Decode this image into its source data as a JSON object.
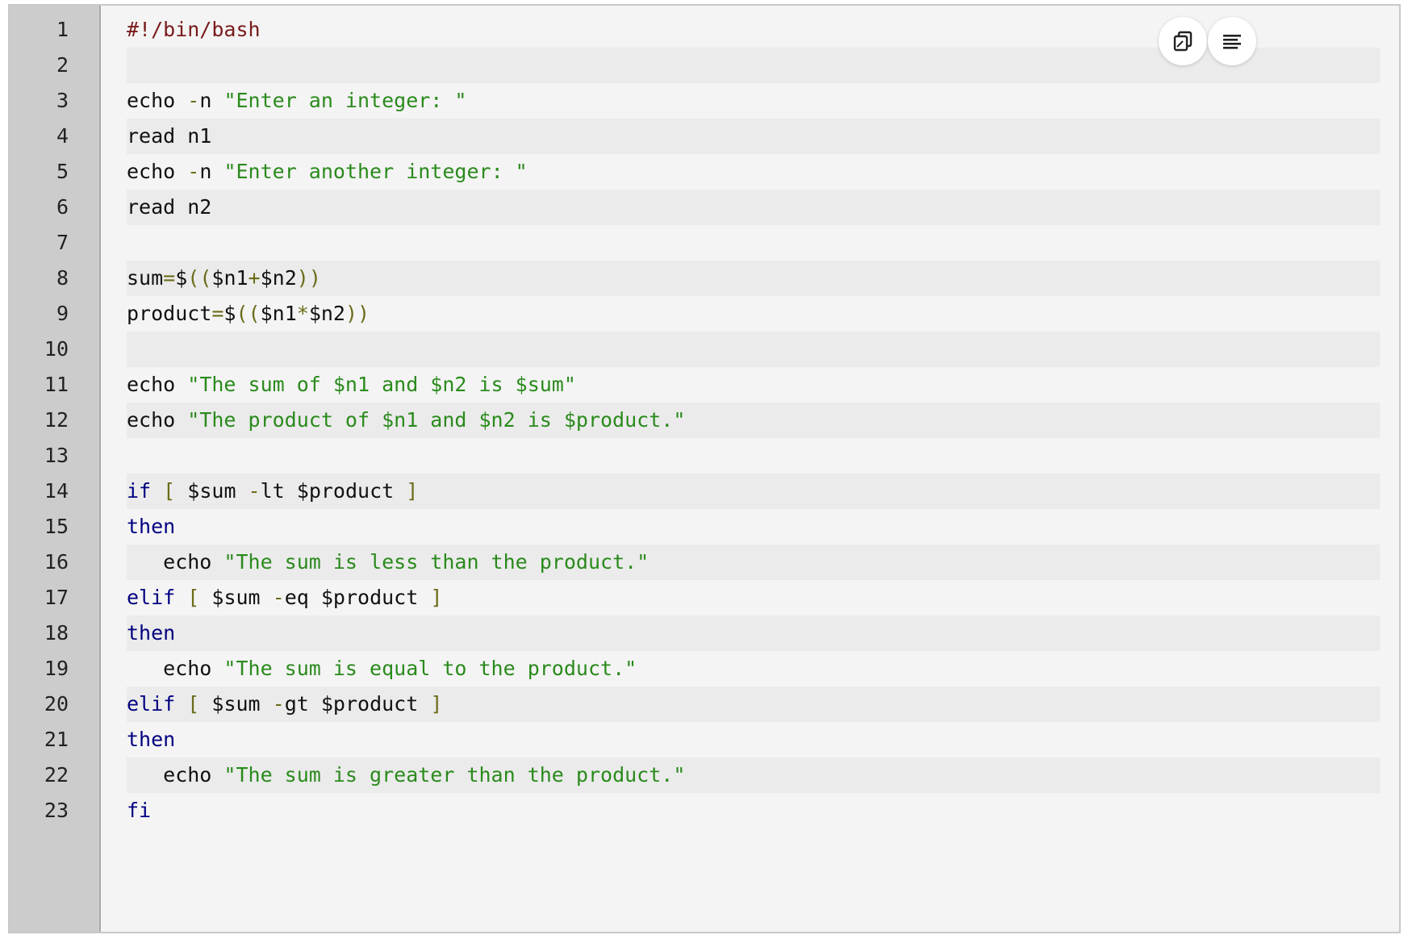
{
  "toolbar": {
    "copy_icon": "copy-icon",
    "wrap_icon": "text-lines-icon"
  },
  "lines": [
    {
      "n": "1",
      "tokens": [
        {
          "t": "shebang",
          "v": "#!/bin/bash"
        }
      ]
    },
    {
      "n": "2",
      "tokens": []
    },
    {
      "n": "3",
      "tokens": [
        {
          "t": "plain",
          "v": "echo "
        },
        {
          "t": "op",
          "v": "-"
        },
        {
          "t": "plain",
          "v": "n "
        },
        {
          "t": "str",
          "v": "\"Enter an integer: \""
        }
      ]
    },
    {
      "n": "4",
      "tokens": [
        {
          "t": "plain",
          "v": "read n1"
        }
      ]
    },
    {
      "n": "5",
      "tokens": [
        {
          "t": "plain",
          "v": "echo "
        },
        {
          "t": "op",
          "v": "-"
        },
        {
          "t": "plain",
          "v": "n "
        },
        {
          "t": "str",
          "v": "\"Enter another integer: \""
        }
      ]
    },
    {
      "n": "6",
      "tokens": [
        {
          "t": "plain",
          "v": "read n2"
        }
      ]
    },
    {
      "n": "7",
      "tokens": []
    },
    {
      "n": "8",
      "tokens": [
        {
          "t": "plain",
          "v": "sum"
        },
        {
          "t": "op",
          "v": "="
        },
        {
          "t": "plain",
          "v": "$"
        },
        {
          "t": "op",
          "v": "(("
        },
        {
          "t": "plain",
          "v": "$n1"
        },
        {
          "t": "op",
          "v": "+"
        },
        {
          "t": "plain",
          "v": "$n2"
        },
        {
          "t": "op",
          "v": "))"
        }
      ]
    },
    {
      "n": "9",
      "tokens": [
        {
          "t": "plain",
          "v": "product"
        },
        {
          "t": "op",
          "v": "="
        },
        {
          "t": "plain",
          "v": "$"
        },
        {
          "t": "op",
          "v": "(("
        },
        {
          "t": "plain",
          "v": "$n1"
        },
        {
          "t": "op",
          "v": "*"
        },
        {
          "t": "plain",
          "v": "$n2"
        },
        {
          "t": "op",
          "v": "))"
        }
      ]
    },
    {
      "n": "10",
      "tokens": []
    },
    {
      "n": "11",
      "tokens": [
        {
          "t": "plain",
          "v": "echo "
        },
        {
          "t": "str",
          "v": "\"The sum of $n1 and $n2 is $sum\""
        }
      ]
    },
    {
      "n": "12",
      "tokens": [
        {
          "t": "plain",
          "v": "echo "
        },
        {
          "t": "str",
          "v": "\"The product of $n1 and $n2 is $product.\""
        }
      ]
    },
    {
      "n": "13",
      "tokens": []
    },
    {
      "n": "14",
      "tokens": [
        {
          "t": "kw",
          "v": "if"
        },
        {
          "t": "plain",
          "v": " "
        },
        {
          "t": "op",
          "v": "["
        },
        {
          "t": "plain",
          "v": " $sum "
        },
        {
          "t": "op",
          "v": "-"
        },
        {
          "t": "plain",
          "v": "lt $product "
        },
        {
          "t": "op",
          "v": "]"
        }
      ]
    },
    {
      "n": "15",
      "tokens": [
        {
          "t": "kw",
          "v": "then"
        }
      ]
    },
    {
      "n": "16",
      "tokens": [
        {
          "t": "plain",
          "v": "   echo "
        },
        {
          "t": "str",
          "v": "\"The sum is less than the product.\""
        }
      ]
    },
    {
      "n": "17",
      "tokens": [
        {
          "t": "kw",
          "v": "elif"
        },
        {
          "t": "plain",
          "v": " "
        },
        {
          "t": "op",
          "v": "["
        },
        {
          "t": "plain",
          "v": " $sum "
        },
        {
          "t": "op",
          "v": "-"
        },
        {
          "t": "plain",
          "v": "eq $product "
        },
        {
          "t": "op",
          "v": "]"
        }
      ]
    },
    {
      "n": "18",
      "tokens": [
        {
          "t": "kw",
          "v": "then"
        }
      ]
    },
    {
      "n": "19",
      "tokens": [
        {
          "t": "plain",
          "v": "   echo "
        },
        {
          "t": "str",
          "v": "\"The sum is equal to the product.\""
        }
      ]
    },
    {
      "n": "20",
      "tokens": [
        {
          "t": "kw",
          "v": "elif"
        },
        {
          "t": "plain",
          "v": " "
        },
        {
          "t": "op",
          "v": "["
        },
        {
          "t": "plain",
          "v": " $sum "
        },
        {
          "t": "op",
          "v": "-"
        },
        {
          "t": "plain",
          "v": "gt $product "
        },
        {
          "t": "op",
          "v": "]"
        }
      ]
    },
    {
      "n": "21",
      "tokens": [
        {
          "t": "kw",
          "v": "then"
        }
      ]
    },
    {
      "n": "22",
      "tokens": [
        {
          "t": "plain",
          "v": "   echo "
        },
        {
          "t": "str",
          "v": "\"The sum is greater than the product.\""
        }
      ]
    },
    {
      "n": "23",
      "tokens": [
        {
          "t": "kw",
          "v": "fi"
        }
      ]
    }
  ],
  "colors": {
    "keyword": "#000080",
    "string": "#2a8a1c",
    "shebang": "#7a1a1a",
    "operator": "#6b6b1a",
    "gutter_bg": "#cccccc",
    "code_bg": "#f4f4f4",
    "shaded_line_bg": "#ebebeb"
  }
}
